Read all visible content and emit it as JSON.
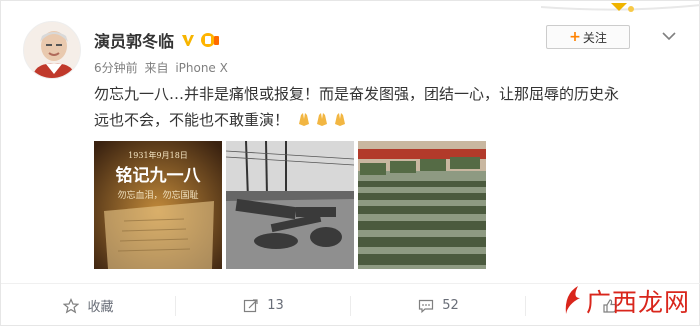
{
  "post": {
    "author": "演员郭冬临",
    "time": "6分钟前",
    "source_prefix": "来自",
    "source": "iPhone X",
    "follow_label": "+关注",
    "follow_plus": "+",
    "follow_text": "关注",
    "line1": "勿忘九一八…并非是痛恨或报复！而是奋发图强，团结一心，让那屈辱的历史永",
    "line2": "远也不会，不能也不敢重演！"
  },
  "images": [
    {
      "date": "1931年9月18日",
      "title": "铭记九一八",
      "subtitle": "勿忘血泪，勿忘国耻"
    }
  ],
  "footer": {
    "fav_label": "收藏",
    "repost_count": "13",
    "comment_count": "52",
    "like_count": ""
  },
  "watermark": {
    "text": "广西龙网"
  },
  "colors": {
    "accent": "#ff8200",
    "badge": "#f7b500",
    "watermark": "#d9261c"
  }
}
